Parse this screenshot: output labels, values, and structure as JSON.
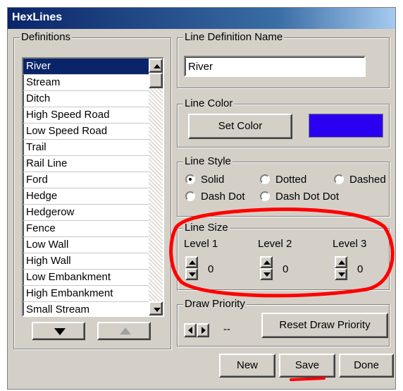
{
  "window": {
    "title": "HexLines"
  },
  "definitions": {
    "legend": "Definitions",
    "items": [
      "River",
      "Stream",
      "Ditch",
      "High Speed Road",
      "Low Speed Road",
      "Trail",
      "Rail Line",
      "Ford",
      "Hedge",
      "Hedgerow",
      "Fence",
      "Low Wall",
      "High Wall",
      "Low Embankment",
      "High Embankment",
      "Small Stream"
    ],
    "selected": "River"
  },
  "name_group": {
    "legend": "Line Definition Name",
    "value": "River"
  },
  "color_group": {
    "legend": "Line Color",
    "button": "Set Color",
    "swatch": "#2b00f0"
  },
  "style_group": {
    "legend": "Line Style",
    "options": [
      "Solid",
      "Dotted",
      "Dashed",
      "Dash Dot",
      "Dash Dot Dot"
    ],
    "selected": "Solid"
  },
  "size_group": {
    "legend": "Line Size",
    "levels": [
      {
        "label": "Level 1",
        "value": "0"
      },
      {
        "label": "Level 2",
        "value": "0"
      },
      {
        "label": "Level 3",
        "value": "0"
      }
    ]
  },
  "priority_group": {
    "legend": "Draw Priority",
    "value": "--",
    "reset_button": "Reset Draw Priority"
  },
  "actions": {
    "new": "New",
    "save": "Save",
    "done": "Done"
  },
  "annotation_color": "#ff0000"
}
